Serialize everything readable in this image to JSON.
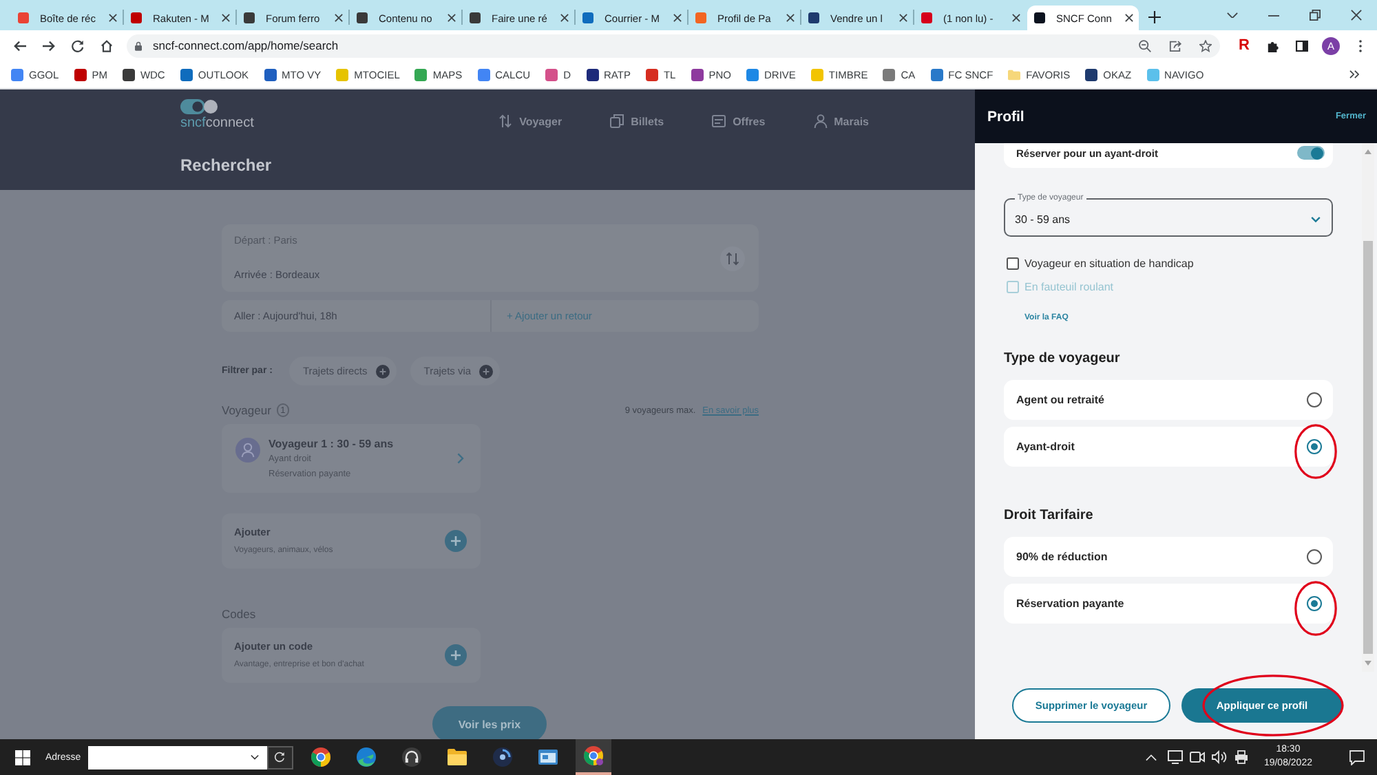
{
  "browser": {
    "tabs": [
      {
        "title": "Boîte de réc",
        "color": "#ea4335",
        "selected": false
      },
      {
        "title": "Rakuten - M",
        "color": "#bf0000",
        "selected": false
      },
      {
        "title": "Forum ferro",
        "color": "#3a3a3a",
        "selected": false
      },
      {
        "title": "Contenu no",
        "color": "#3a3a3a",
        "selected": false
      },
      {
        "title": "Faire une ré",
        "color": "#3a3a3a",
        "selected": false
      },
      {
        "title": "Courrier - M",
        "color": "#0f6cbd",
        "selected": false
      },
      {
        "title": "Profil de Pa",
        "color": "#f26522",
        "selected": false
      },
      {
        "title": "Vendre un l",
        "color": "#1e3a6e",
        "selected": false
      },
      {
        "title": "(1 non lu) -",
        "color": "#d6001c",
        "selected": false
      },
      {
        "title": "SNCF Conn",
        "color": "#0c131f",
        "selected": true
      }
    ],
    "url": "sncf-connect.com/app/home/search",
    "extension_label": "R",
    "profile_initial": "A",
    "bookmarks": [
      {
        "label": "GGOL",
        "kind": "link",
        "color": "#4285f4"
      },
      {
        "label": "PM",
        "kind": "link",
        "color": "#bf0000"
      },
      {
        "label": "WDC",
        "kind": "link",
        "color": "#3a3a3a"
      },
      {
        "label": "OUTLOOK",
        "kind": "link",
        "color": "#0f6cbd"
      },
      {
        "label": "MTO VY",
        "kind": "link",
        "color": "#1f5fbf"
      },
      {
        "label": "MTOCIEL",
        "kind": "link",
        "color": "#e6c300"
      },
      {
        "label": "MAPS",
        "kind": "link",
        "color": "#34a853"
      },
      {
        "label": "CALCU",
        "kind": "link",
        "color": "#4285f4"
      },
      {
        "label": "D",
        "kind": "link",
        "color": "#d4508a"
      },
      {
        "label": "RATP",
        "kind": "link",
        "color": "#1d2a7a"
      },
      {
        "label": "TL",
        "kind": "link",
        "color": "#d62d20"
      },
      {
        "label": "PNO",
        "kind": "link",
        "color": "#8e3a9e"
      },
      {
        "label": "DRIVE",
        "kind": "link",
        "color": "#1e88e5"
      },
      {
        "label": "TIMBRE",
        "kind": "link",
        "color": "#f2c400"
      },
      {
        "label": "CA",
        "kind": "link",
        "color": "#7a7a7a"
      },
      {
        "label": "FC SNCF",
        "kind": "link",
        "color": "#2979c9"
      },
      {
        "label": "FAVORIS",
        "kind": "folder",
        "color": "#f6d77a"
      },
      {
        "label": "OKAZ",
        "kind": "link",
        "color": "#1e3a6e"
      },
      {
        "label": "NAVIGO",
        "kind": "link",
        "color": "#5bc0eb"
      }
    ]
  },
  "site": {
    "logo": [
      "sncf",
      "connect"
    ],
    "nav": [
      "Voyager",
      "Billets",
      "Offres",
      "Marais"
    ],
    "title": "Rechercher",
    "search": {
      "departure": "Départ : Paris",
      "arrival": "Arrivée : Bordeaux",
      "outbound": "Aller : Aujourd'hui, 18h",
      "add_return": "+ Ajouter un retour"
    },
    "filters": {
      "label": "Filtrer par :",
      "chips": [
        "Trajets directs",
        "Trajets via"
      ]
    },
    "travelers": {
      "heading": "Voyageur",
      "count": "1",
      "max_note": "9 voyageurs max.",
      "more_link": "En savoir plus",
      "list": [
        {
          "name": "Voyageur 1 : 30 - 59 ans",
          "details": [
            "Ayant droit",
            "Réservation payante"
          ]
        }
      ]
    },
    "add_card": {
      "title": "Ajouter",
      "subtitle": "Voyageurs, animaux, vélos"
    },
    "codes": {
      "heading": "Codes",
      "title": "Ajouter un code",
      "subtitle": "Avantage, entreprise et bon d'achat"
    },
    "submit": "Voir les prix"
  },
  "profile_panel": {
    "title": "Profil",
    "close": "Fermer",
    "entitled_toggle": {
      "label": "Réserver pour un ayant-droit",
      "on": true
    },
    "traveler_type_select": {
      "label": "Type de voyageur",
      "value": "30 - 59 ans"
    },
    "checkboxes": [
      {
        "label": "Voyageur en situation de handicap",
        "checked": false,
        "disabled": false
      },
      {
        "label": "En fauteuil roulant",
        "checked": false,
        "disabled": true
      }
    ],
    "faq_link": "Voir la FAQ",
    "sections": [
      {
        "heading": "Type de voyageur",
        "options": [
          {
            "label": "Agent ou retraité",
            "selected": false,
            "annotated": false
          },
          {
            "label": "Ayant-droit",
            "selected": true,
            "annotated": true
          }
        ]
      },
      {
        "heading": "Droit Tarifaire",
        "options": [
          {
            "label": "90% de réduction",
            "selected": false,
            "annotated": false
          },
          {
            "label": "Réservation payante",
            "selected": true,
            "annotated": true
          }
        ]
      }
    ],
    "buttons": [
      {
        "label": "Supprimer le voyageur",
        "kind": "secondary",
        "annotated": false
      },
      {
        "label": "Appliquer ce profil",
        "kind": "primary",
        "annotated": true
      }
    ]
  },
  "taskbar": {
    "address_label": "Adresse",
    "apps": [
      {
        "active": false
      },
      {
        "active": false
      },
      {
        "active": false
      },
      {
        "active": false
      },
      {
        "active": false
      },
      {
        "active": false
      },
      {
        "active": true
      }
    ],
    "time": "18:30",
    "date": "19/08/2022"
  }
}
